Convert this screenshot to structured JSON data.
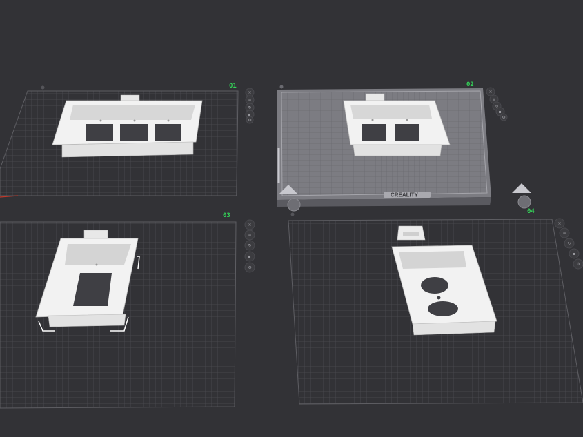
{
  "plates": [
    {
      "id": "plate-01",
      "label": "01"
    },
    {
      "id": "plate-02",
      "label": "02",
      "brand": "CREALITY"
    },
    {
      "id": "plate-03",
      "label": "03"
    },
    {
      "id": "plate-04",
      "label": "04"
    }
  ],
  "plate_tools": {
    "close_icon": "×",
    "arrange_icon": "≡",
    "orient_icon": "↻",
    "lock_icon": "▪",
    "settings_icon": "⚙"
  },
  "colors": {
    "background": "#323236",
    "grid_line": "#55555a",
    "plate_border": "#5e5e63",
    "active_plate": "#8a8a90",
    "model": "#eeeeee",
    "label": "#34d058"
  }
}
